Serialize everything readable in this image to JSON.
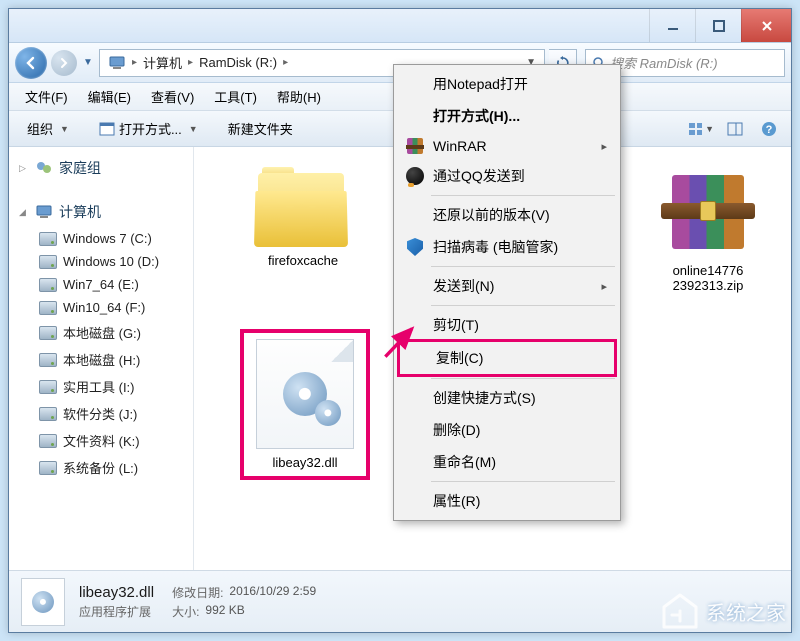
{
  "titlebar": {},
  "navbar": {
    "breadcrumb": [
      "计算机",
      "RamDisk (R:)"
    ],
    "search_placeholder": "搜索 RamDisk (R:)"
  },
  "menubar": {
    "items": [
      "文件(F)",
      "编辑(E)",
      "查看(V)",
      "工具(T)",
      "帮助(H)"
    ]
  },
  "toolbar": {
    "organize": "组织",
    "open_with": "打开方式...",
    "new_folder": "新建文件夹"
  },
  "sidebar": {
    "homegroup": "家庭组",
    "computer": "计算机",
    "drives": [
      "Windows 7 (C:)",
      "Windows 10 (D:)",
      "Win7_64 (E:)",
      "Win10_64 (F:)",
      "本地磁盘 (G:)",
      "本地磁盘 (H:)",
      "实用工具 (I:)",
      "软件分类 (J:)",
      "文件资料 (K:)",
      "系统备份 (L:)"
    ]
  },
  "files": {
    "folder1": "firefoxcache",
    "dll": "libeay32.dll",
    "zip": "online14776\n2392313.zip"
  },
  "context_menu": {
    "open_notepad": "用Notepad打开",
    "open_with": "打开方式(H)...",
    "winrar": "WinRAR",
    "qq_send": "通过QQ发送到",
    "restore": "还原以前的版本(V)",
    "scan_virus": "扫描病毒 (电脑管家)",
    "send_to": "发送到(N)",
    "cut": "剪切(T)",
    "copy": "复制(C)",
    "shortcut": "创建快捷方式(S)",
    "delete": "删除(D)",
    "rename": "重命名(M)",
    "properties": "属性(R)"
  },
  "details": {
    "name": "libeay32.dll",
    "type": "应用程序扩展",
    "mod_label": "修改日期:",
    "mod_value": "2016/10/29 2:59",
    "size_label": "大小:",
    "size_value": "992 KB"
  },
  "watermark": "系统之家",
  "highlight_color": "#e6006b"
}
